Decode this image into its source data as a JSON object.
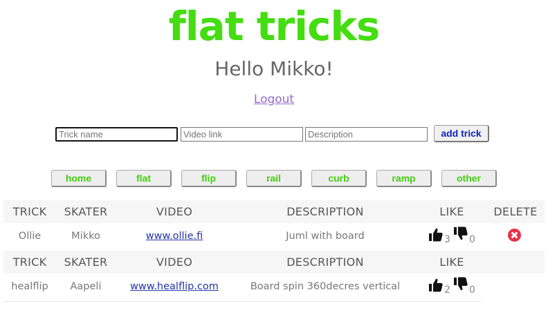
{
  "app": {
    "title": "flat tricks",
    "greeting": "Hello Mikko!",
    "logout_label": "Logout"
  },
  "form": {
    "trick_placeholder": "Trick name",
    "video_placeholder": "Video link",
    "description_placeholder": "Description",
    "add_label": "add trick"
  },
  "categories": [
    "home",
    "flat",
    "flip",
    "rail",
    "curb",
    "ramp",
    "other"
  ],
  "table": {
    "headers": {
      "trick": "TRICK",
      "skater": "SKATER",
      "video": "VIDEO",
      "description": "DESCRIPTION",
      "like": "LIKE",
      "delete": "DELETE"
    },
    "rows": [
      {
        "trick": "Ollie",
        "skater": "Mikko",
        "video": "www.ollie.fi",
        "description": "Juml with board",
        "likes": "3",
        "dislikes": "0",
        "deletable": true
      },
      {
        "trick": "healflip",
        "skater": "Aapeli",
        "video": "www.healflip.com",
        "description": "Board spin 360decres vertical",
        "likes": "2",
        "dislikes": "0",
        "deletable": false
      }
    ]
  },
  "colors": {
    "brand": "#44dd11",
    "category_text": "#44cc11",
    "delete": "#e8334a",
    "link": "#2233aa"
  },
  "icons": {
    "like": "thumbs-up-icon",
    "dislike": "thumbs-down-icon",
    "delete": "delete-circle-icon"
  }
}
